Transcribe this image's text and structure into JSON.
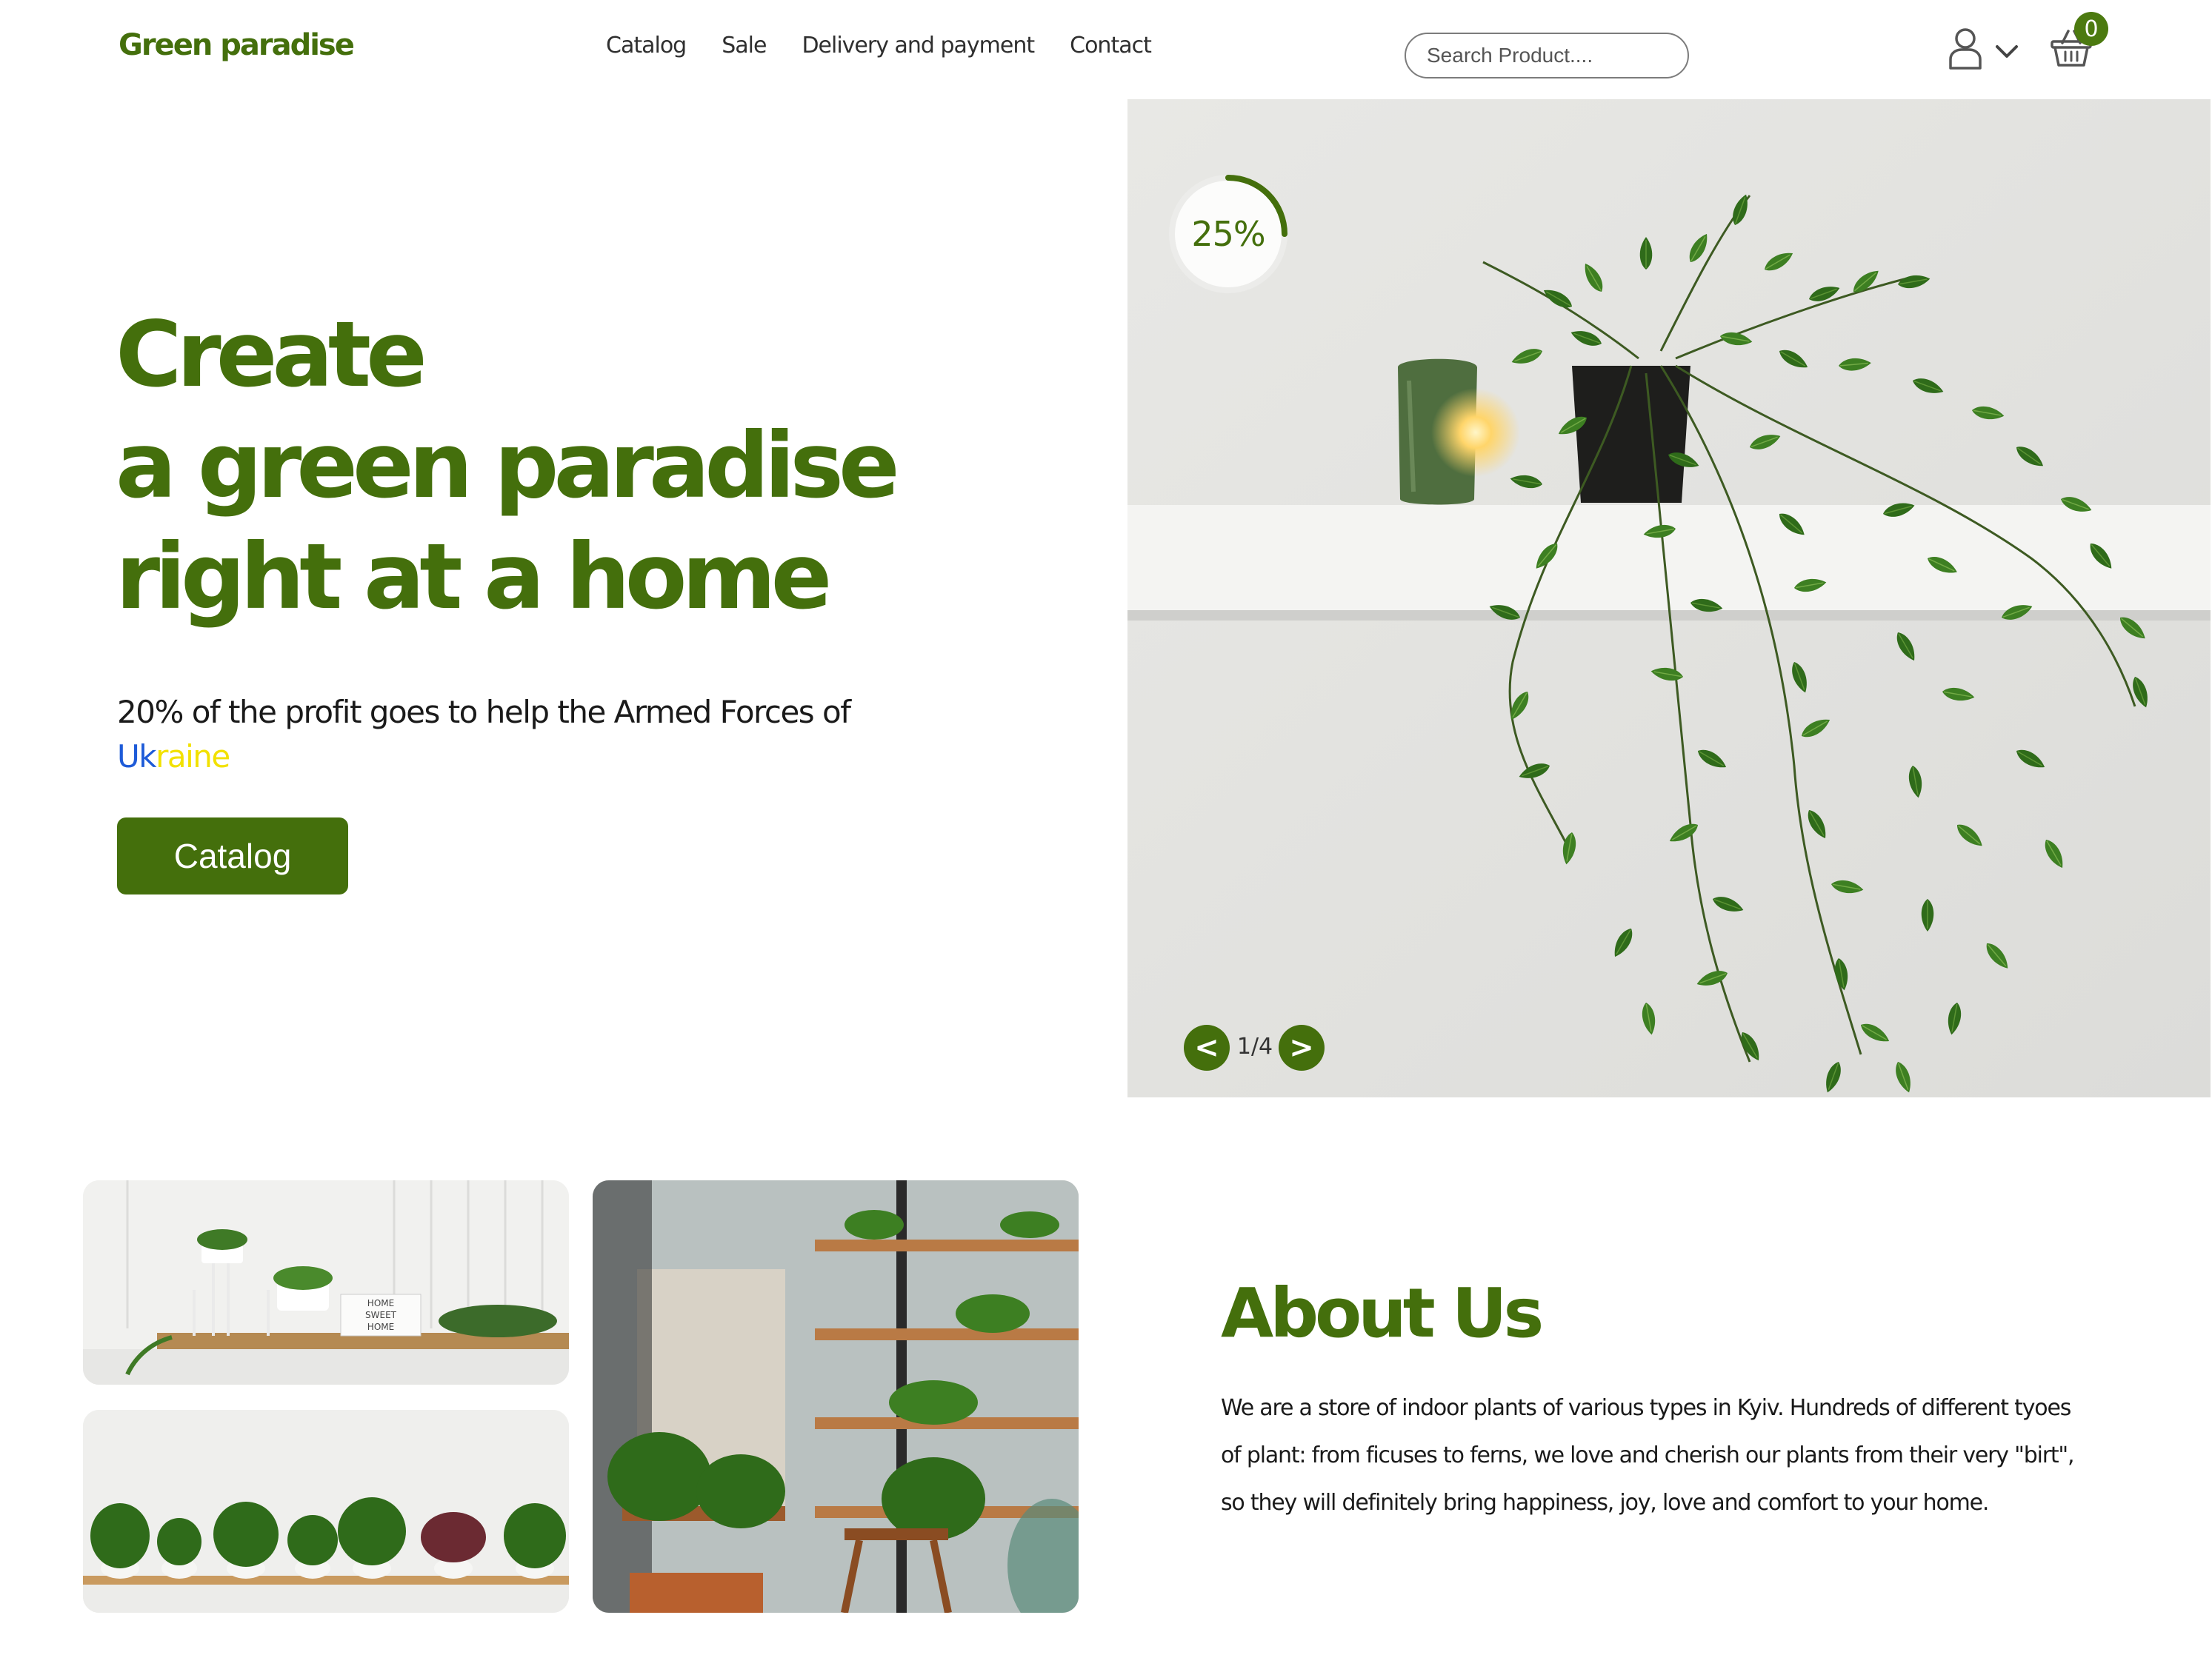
{
  "header": {
    "logo": "Green paradise",
    "nav": [
      "Catalog",
      "Sale",
      "Delivery and payment",
      "Contact"
    ],
    "search_placeholder": "Search Product....",
    "cart_count": "0"
  },
  "hero": {
    "title_lines": [
      "Create",
      "a green paradise",
      "right at a home"
    ],
    "subtitle": "20% of the profit goes to help the Armed Forces of",
    "ukraine_part1": "Uk",
    "ukraine_part2": "raine",
    "cta_label": "Catalog",
    "progress_percent": 25,
    "progress_label": "25%",
    "slide_prev": "<",
    "slide_next": ">",
    "slide_counter": "1/4"
  },
  "about": {
    "title": "About Us",
    "text": "We are a store of indoor plants of various types in Kyiv. Hundreds of different tyoes of plant: from ficuses to ferns, we love and cherish our plants from their very \"birt\", so they will definitely bring happiness, joy, love and comfort to your home."
  },
  "gallery": {
    "sign_text": "HOME SWEET HOME"
  },
  "colors": {
    "brand_green": "#446f0c",
    "ukraine_blue": "#1e5bd8",
    "ukraine_yellow": "#f2e100"
  }
}
